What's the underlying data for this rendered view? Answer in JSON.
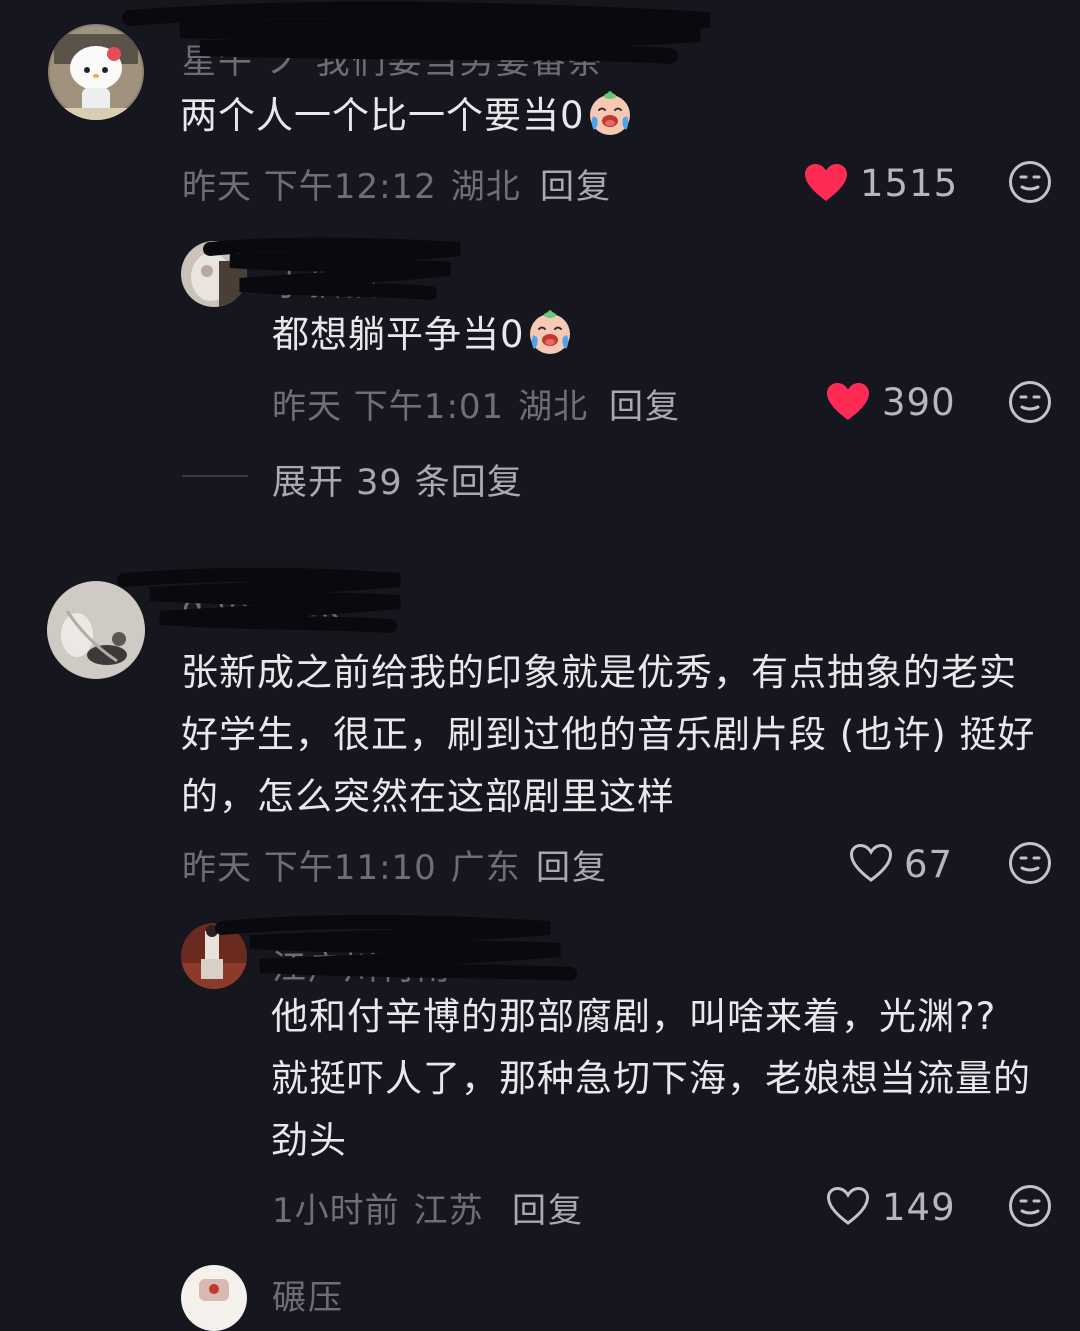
{
  "comments": [
    {
      "username": "星午 ノ 我们要当男妻番茶",
      "text": "两个人一个比一个要当0",
      "time": "昨天 下午12:12",
      "location": "湖北",
      "reply_label": "回复",
      "likes": "1515",
      "liked": true,
      "reply": {
        "username": "小猫猫",
        "text": "都想躺平争当0",
        "time": "昨天 下午1:01",
        "location": "湖北",
        "reply_label": "回复",
        "likes": "390",
        "liked": true
      },
      "expand_label": "展开 39 条回复"
    },
    {
      "username": "dadaook",
      "text_lines": [
        "张新成之前给我的印象就是优秀，有点抽象的老实",
        "好学生，很正，刷到过他的音乐剧片段 (也许) 挺好",
        "的，怎么突然在这部剧里这样"
      ],
      "time": "昨天 下午11:10",
      "location": "广东",
      "reply_label": "回复",
      "likes": "67",
      "liked": false,
      "reply": {
        "username": "江户川柯南",
        "text_lines": [
          "他和付辛博的那部腐剧，叫啥来着，光渊??",
          "就挺吓人了，那种急切下海，老娘想当流量的",
          "劲头"
        ],
        "time": "1小时前",
        "location": "江苏",
        "reply_label": "回复",
        "likes": "149",
        "liked": false
      }
    },
    {
      "username": "碾压"
    }
  ],
  "colors": {
    "background": "#16161e",
    "heart_active": "#fe2c55",
    "text_primary": "#e8e8ec",
    "text_secondary": "#6e6e77"
  },
  "icons": {
    "like": "heart-icon",
    "emoji": "emoji-icon",
    "crying": "crying-emoji"
  }
}
